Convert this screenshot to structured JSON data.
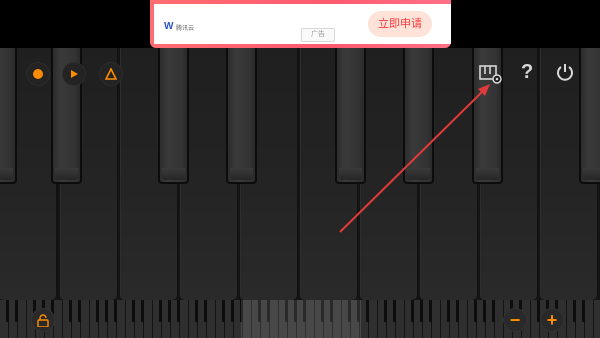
{
  "ad": {
    "brand": "腾讯云",
    "tag": "广告",
    "cta": "立即申请",
    "close": "✕",
    "logo": "W"
  },
  "toolbar": {
    "record_icon": "record-icon",
    "play_icon": "play-icon",
    "metronome_icon": "metronome-icon",
    "settings_icon": "keyboard-settings-icon",
    "help": "?",
    "power_icon": "power-icon"
  },
  "bottom": {
    "lock_icon": "lock-icon",
    "zoom_out": "−",
    "zoom_in": "+"
  },
  "colors": {
    "accent": "#ff8c00",
    "annotation": "#e03a3a",
    "ad_gradient": "#ff5a6f",
    "cta_text": "#ff3b3b"
  }
}
